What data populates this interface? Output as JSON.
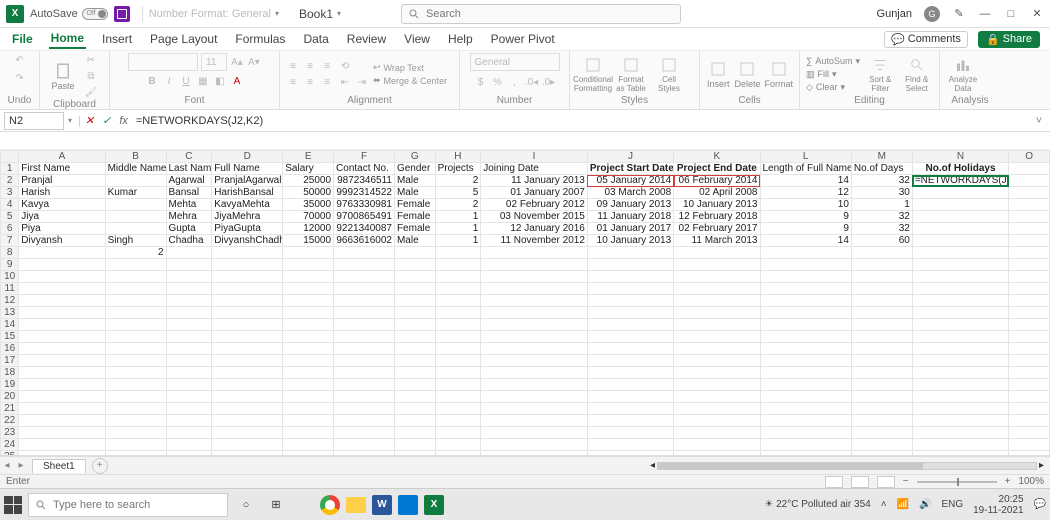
{
  "titlebar": {
    "autosave": "AutoSave",
    "off": "Off",
    "numberformat": "Number Format: General",
    "book": "Book1",
    "search_placeholder": "Search",
    "user": "Gunjan",
    "user_initial": "G"
  },
  "tabs": {
    "file": "File",
    "list": [
      "Home",
      "Insert",
      "Page Layout",
      "Formulas",
      "Data",
      "Review",
      "View",
      "Help",
      "Power Pivot"
    ],
    "comments": "Comments",
    "share": "Share"
  },
  "ribbon": {
    "undo": "Undo",
    "clipboard": "Clipboard",
    "paste": "Paste",
    "font": "Font",
    "fontsize": "11",
    "alignment": "Alignment",
    "wrap": "Wrap Text",
    "merge": "Merge & Center",
    "number": "Number",
    "general": "General",
    "styles": "Styles",
    "cond": "Conditional Formatting",
    "fmt": "Format as Table",
    "cell": "Cell Styles",
    "cells": "Cells",
    "insert": "Insert",
    "delete": "Delete",
    "format": "Format",
    "editing": "Editing",
    "autosum": "AutoSum",
    "fill": "Fill",
    "clear": "Clear",
    "sortfilter": "Sort & Filter",
    "findselect": "Find & Select",
    "analysis": "Analysis",
    "analyze": "Analyze Data"
  },
  "fbar": {
    "cell": "N2",
    "formula": "=NETWORKDAYS(J2,K2)",
    "editing_formula": "=NETWORKDAYS(J2,K2)"
  },
  "cols": [
    "A",
    "B",
    "C",
    "D",
    "E",
    "F",
    "G",
    "H",
    "I",
    "J",
    "K",
    "L",
    "M",
    "N",
    "O"
  ],
  "headers": {
    "A": "First Name",
    "B": "Middle Name",
    "C": "Last Name",
    "D": "Full Name",
    "E": "Salary",
    "F": "Contact No.",
    "G": "Gender",
    "H": "Projects",
    "I": "Joining Date",
    "J": "Project Start Date",
    "K": "Project End Date",
    "L": "Length of Full Names",
    "M": "No.of Days",
    "N": "No.of Holidays"
  },
  "rows": [
    {
      "A": "Pranjal",
      "B": "",
      "C": "Agarwal",
      "D": "PranjalAgarwal",
      "E": "25000",
      "F": "9872346511",
      "G": "Male",
      "H": "2",
      "I": "11 January 2013",
      "J": "05 January 2014",
      "K": "06 February 2014",
      "L": "14",
      "M": "32",
      "N": "=NETWORKDAYS(J2,K2)"
    },
    {
      "A": "Harish",
      "B": "Kumar",
      "C": "Bansal",
      "D": "HarishBansal",
      "E": "50000",
      "F": "9992314522",
      "G": "Male",
      "H": "5",
      "I": "01 January 2007",
      "J": "03 March 2008",
      "K": "02 April 2008",
      "L": "12",
      "M": "30",
      "N": ""
    },
    {
      "A": "Kavya",
      "B": "",
      "C": "Mehta",
      "D": "KavyaMehta",
      "E": "35000",
      "F": "9763330981",
      "G": "Female",
      "H": "2",
      "I": "02 February 2012",
      "J": "09 January 2013",
      "K": "10 January 2013",
      "L": "10",
      "M": "1",
      "N": ""
    },
    {
      "A": "Jiya",
      "B": "",
      "C": "Mehra",
      "D": "JiyaMehra",
      "E": "70000",
      "F": "9700865491",
      "G": "Female",
      "H": "1",
      "I": "03 November 2015",
      "J": "11 January 2018",
      "K": "12 February 2018",
      "L": "9",
      "M": "32",
      "N": ""
    },
    {
      "A": "Piya",
      "B": "",
      "C": "Gupta",
      "D": "PiyaGupta",
      "E": "12000",
      "F": "9221340087",
      "G": "Female",
      "H": "1",
      "I": "12 January 2016",
      "J": "01 January 2017",
      "K": "02 February 2017",
      "L": "9",
      "M": "32",
      "N": ""
    },
    {
      "A": "Divyansh",
      "B": "Singh",
      "C": "Chadha",
      "D": "DivyanshChadha",
      "E": "15000",
      "F": "9663616002",
      "G": "Male",
      "H": "1",
      "I": "11 November 2012",
      "J": "10 January 2013",
      "K": "11 March 2013",
      "L": "14",
      "M": "60",
      "N": ""
    }
  ],
  "row8": {
    "B": "2"
  },
  "sheet": {
    "name": "Sheet1"
  },
  "status": {
    "mode": "Enter",
    "zoom": "100%"
  },
  "taskbar": {
    "search": "Type here to search",
    "weather": "22°C Polluted air 354",
    "lang": "ENG",
    "time": "20:25",
    "date": "19-11-2021"
  }
}
